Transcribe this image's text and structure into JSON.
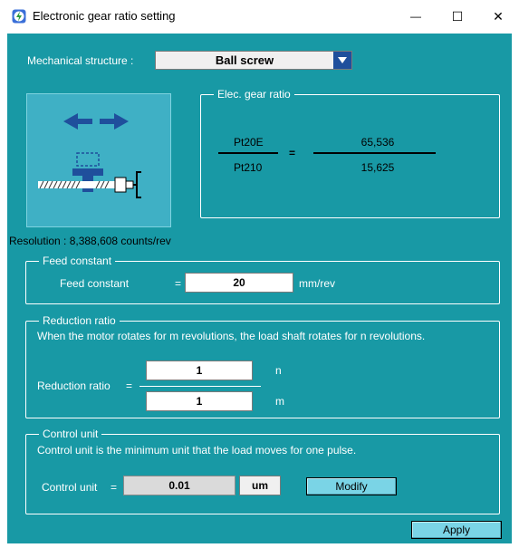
{
  "window": {
    "title": "Electronic gear ratio setting",
    "minimize_glyph": "—",
    "maximize_glyph": "☐",
    "close_glyph": "✕"
  },
  "mechanical": {
    "label": "Mechanical structure :",
    "value": "Ball screw"
  },
  "gear_ratio": {
    "title": "Elec. gear ratio",
    "numerator_param": "Pt20E",
    "denominator_param": "Pt210",
    "equals": "=",
    "numerator_value": "65,536",
    "denominator_value": "15,625"
  },
  "resolution": {
    "text": "Resolution : 8,388,608 counts/rev"
  },
  "feed": {
    "group_title": "Feed constant",
    "label": "Feed constant",
    "equals": "=",
    "value": "20",
    "unit": "mm/rev"
  },
  "reduction": {
    "group_title": "Reduction ratio",
    "description": "When the motor rotates for m revolutions, the load shaft rotates for n revolutions.",
    "label": "Reduction ratio",
    "equals": "=",
    "n_value": "1",
    "n_label": "n",
    "m_value": "1",
    "m_label": "m"
  },
  "control": {
    "group_title": "Control unit",
    "description": "Control unit is the minimum unit that the load moves for one pulse.",
    "label": "Control unit",
    "equals": "=",
    "value": "0.01",
    "unit": "um",
    "modify_label": "Modify"
  },
  "apply_label": "Apply",
  "colors": {
    "background": "#1899a5",
    "illustration": "#3fb0c5",
    "dropdown_arrow": "#1f4f9c",
    "button": "#7ad4e6"
  }
}
